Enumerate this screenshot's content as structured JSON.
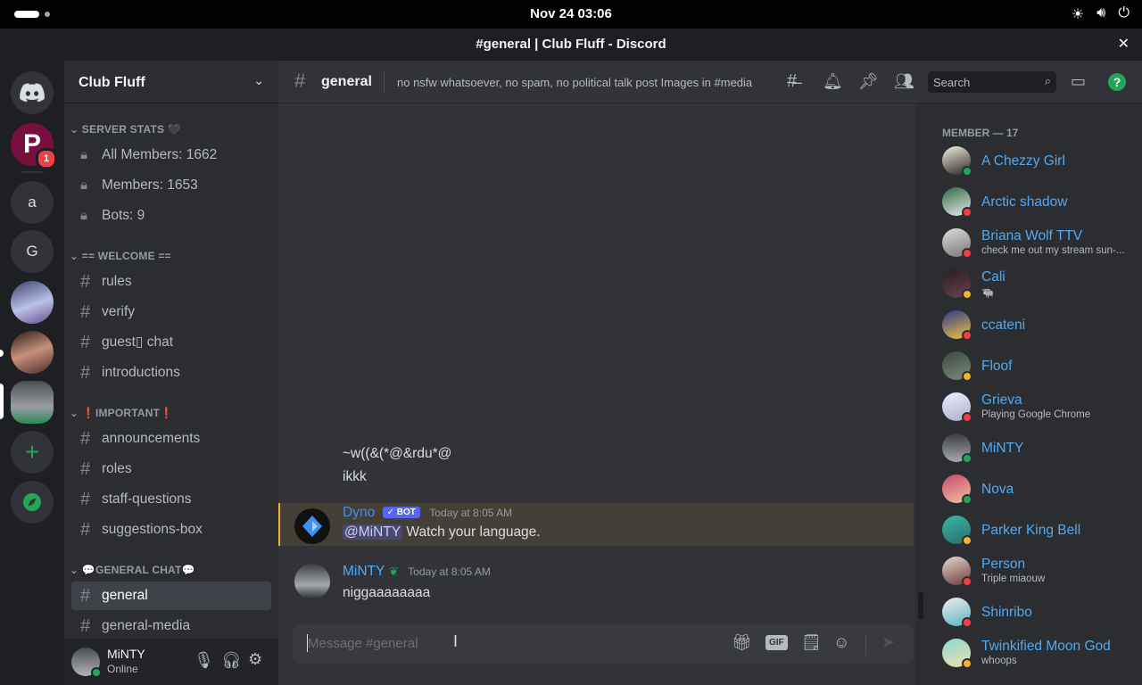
{
  "system": {
    "clock": "Nov 24  03:06"
  },
  "window": {
    "title": "#general | Club Fluff - Discord"
  },
  "guilds": [
    {
      "label": "",
      "icon": "discord-logo-icon"
    },
    {
      "label": "P",
      "badge": "1"
    },
    {
      "label": "a"
    },
    {
      "label": "G"
    },
    {
      "label": "",
      "icon": "anime-girl-avatar"
    },
    {
      "label": "",
      "icon": "anime-character-avatar"
    },
    {
      "label": "",
      "icon": "koala-avatar"
    },
    {
      "label": "+",
      "icon": "add-server-icon"
    },
    {
      "label": "",
      "icon": "compass-icon"
    }
  ],
  "server": {
    "name": "Club Fluff"
  },
  "categories": {
    "stats": "SERVER STATS 🖤",
    "welcome": "== WELCOME ==",
    "important": "❗IMPORTANT❗",
    "general_chat": "💬GENERAL CHAT💬"
  },
  "channels": {
    "all_members": "All Members: 1662",
    "members": "Members: 1653",
    "bots": "Bots: 9",
    "rules": "rules",
    "verify": "verify",
    "guest_chat": "guest▯ chat",
    "introductions": "introductions",
    "announcements": "announcements",
    "roles": "roles",
    "staff_questions": "staff-questions",
    "suggestions_box": "suggestions-box",
    "general": "general",
    "general_media": "general-media"
  },
  "user_panel": {
    "name": "MiNTY",
    "status": "Online"
  },
  "channel_header": {
    "name": "general",
    "topic": "no nsfw whatsoever, no spam, no political talk post Images in #media",
    "search_placeholder": "Search"
  },
  "messages": {
    "line1": "~w((&(*@&rdu*@",
    "line2": "ikkk",
    "dyno": {
      "author": "Dyno",
      "tag": "✓ BOT",
      "time": "Today at 8:05 AM",
      "mention": "@MiNTY",
      "text": " Watch your language."
    },
    "minty": {
      "author": "MiNTY",
      "time": "Today at 8:05 AM",
      "text": "niggaaaaaaaa"
    }
  },
  "composer": {
    "placeholder": "Message #general",
    "gif_label": "GIF"
  },
  "members": {
    "header": "MEMBER — 17",
    "list": [
      {
        "name": "A Chezzy Girl",
        "sub": "",
        "status": "online"
      },
      {
        "name": "Arctic shadow",
        "sub": "",
        "status": "dnd"
      },
      {
        "name": "Briana Wolf TTV",
        "sub": "check me out my stream sun-...",
        "status": "dnd"
      },
      {
        "name": "Cali",
        "sub": "🐃",
        "status": "idle"
      },
      {
        "name": "ccateni",
        "sub": "",
        "status": "dnd"
      },
      {
        "name": "Floof",
        "sub": "",
        "status": "idle"
      },
      {
        "name": "Grieva",
        "sub": "Playing Google Chrome",
        "status": "dnd"
      },
      {
        "name": "MiNTY",
        "sub": "",
        "status": "online"
      },
      {
        "name": "Nova",
        "sub": "",
        "status": "online"
      },
      {
        "name": "Parker King Bell",
        "sub": "",
        "status": "idle"
      },
      {
        "name": "Person",
        "sub": "Triple miaouw",
        "status": "dnd"
      },
      {
        "name": "Shinribo",
        "sub": "",
        "status": "dnd"
      },
      {
        "name": "Twinkified Moon God",
        "sub": "whoops",
        "status": "idle"
      }
    ]
  },
  "colors": {
    "accent": "#5865f2",
    "member_name": "#53a9f0",
    "online": "#23a55a",
    "idle": "#f0b232",
    "dnd": "#f23f43",
    "highlight": "#f0b232"
  }
}
